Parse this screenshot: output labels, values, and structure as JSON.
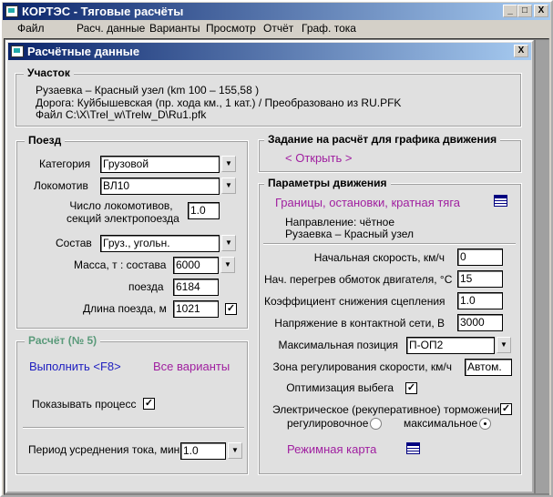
{
  "app": {
    "title": "КОРТЭС - Тяговые расчёты",
    "controls": {
      "minimize": "_",
      "maximize": "□",
      "close": "X"
    }
  },
  "menu": [
    "Файл",
    "Расч. данные",
    "Варианты",
    "Просмотр",
    "Отчёт",
    "Граф. тока"
  ],
  "child": {
    "title": "Расчётные данные",
    "close": "X"
  },
  "section": {
    "title": "Участок",
    "lines": [
      "Рузаевка – Красный узел (km 100 – 155,58 )",
      "Дорога: Куйбышевская (пр. хода км., 1 кат.)  / Преобразовано из RU.PFK",
      "Файл C:\\X\\Trel_w\\Trelw_D\\Ru1.pfk"
    ]
  },
  "train": {
    "title": "Поезд",
    "category_label": "Категория",
    "category": "Грузовой",
    "loco_label": "Локомотив",
    "loco": "ВЛ10",
    "count_label1": "Число  локомотивов,",
    "count_label2": "секций  электропоезда",
    "count": "1.0",
    "consist_label": "Состав",
    "consist": "Груз., угольн.",
    "mass_label": "Масса, т : состава",
    "mass_consist": "6000",
    "mass_train_label": "поезда",
    "mass_train": "6184",
    "length_label": "Длина поезда, м",
    "length": "1021",
    "length_checked": true
  },
  "calc": {
    "title": "Расчёт (№ 5)",
    "run": "Выполнить <F8>",
    "all": "Все варианты",
    "show_label": "Показывать процесс",
    "show_checked": true,
    "period_label": "Период усреднения тока, мин",
    "period": "1.0"
  },
  "task": {
    "title": "Задание на расчёт для графика движения",
    "open": "< Открыть >"
  },
  "motion": {
    "title": "Параметры движения",
    "bounds": "Границы, остановки, кратная тяга",
    "direction": "Направление: чётное",
    "route": "Рузаевка  –  Красный узел",
    "fields": [
      {
        "label": "Начальная  скорость, км/ч",
        "value": "0"
      },
      {
        "label": "Нач. перегрев обмоток двигателя, °C",
        "value": "15"
      },
      {
        "label": "Коэффициент снижения сцепления",
        "value": "1.0"
      },
      {
        "label": "Напряжение в контактной сети, В",
        "value": "3000"
      }
    ],
    "maxpos_label": "Максимальная позиция",
    "maxpos": "П-ОП2",
    "zone_label": "Зона регулирования скорости, км/ч",
    "zone": "Автом.",
    "opt_label": "Оптимизация выбега",
    "opt_checked": true,
    "brake_label": "Электрическое (рекуперативное) торможение:",
    "brake_checked": true,
    "radio1": "регулировочное",
    "radio2": "максимальное",
    "selected": "максимальное",
    "mode_map": "Режимная карта"
  },
  "colors": {
    "title_start": "#0a246a",
    "title_end": "#a6caf0",
    "link_magenta": "#a020a0",
    "run_blue": "#2020c0",
    "calc_green": "#5a9a7a"
  }
}
